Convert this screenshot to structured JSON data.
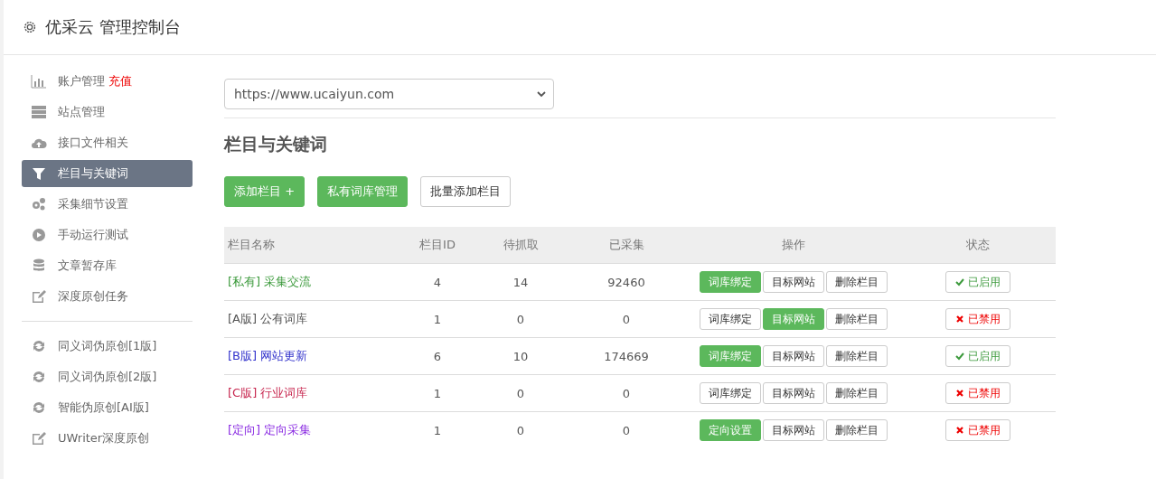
{
  "header": {
    "title": "优采云 管理控制台"
  },
  "sidebar": {
    "items": [
      {
        "label": "账户管理",
        "badge": "充值",
        "selected": false
      },
      {
        "label": "站点管理",
        "selected": false
      },
      {
        "label": "接口文件相关",
        "selected": false
      },
      {
        "label": "栏目与关键词",
        "selected": true
      },
      {
        "label": "采集细节设置",
        "selected": false
      },
      {
        "label": "手动运行测试",
        "selected": false
      },
      {
        "label": "文章暂存库",
        "selected": false
      },
      {
        "label": "深度原创任务",
        "selected": false
      },
      {
        "kind": "divider"
      },
      {
        "label": "同义词伪原创[1版]",
        "selected": false
      },
      {
        "label": "同义词伪原创[2版]",
        "selected": false
      },
      {
        "label": "智能伪原创[AI版]",
        "selected": false
      },
      {
        "label": "UWriter深度原创",
        "selected": false
      }
    ]
  },
  "site_select": {
    "value": "https://www.ucaiyun.com"
  },
  "section_title": "栏目与关键词",
  "toolbar": [
    {
      "label": "添加栏目 +",
      "primary": true
    },
    {
      "label": "私有词库管理",
      "primary": true
    },
    {
      "label": "批量添加栏目",
      "primary": false
    }
  ],
  "table": {
    "columns": [
      "栏目名称",
      "栏目ID",
      "待抓取",
      "已采集",
      "操作",
      "状态"
    ],
    "rows": [
      {
        "tag": "[私有]",
        "name": "采集交流",
        "color": "#3c9a3c",
        "id": "4",
        "pending": "14",
        "collected": "92460",
        "actions": [
          {
            "label": "词库绑定",
            "active": true
          },
          {
            "label": "目标网站",
            "active": false
          },
          {
            "label": "删除栏目",
            "active": false
          }
        ],
        "enabled": true,
        "status": "已启用"
      },
      {
        "tag": "[A版]",
        "name": "公有词库",
        "color": "#555555",
        "id": "1",
        "pending": "0",
        "collected": "0",
        "actions": [
          {
            "label": "词库绑定",
            "active": false
          },
          {
            "label": "目标网站",
            "active": true
          },
          {
            "label": "删除栏目",
            "active": false
          }
        ],
        "enabled": false,
        "status": "已禁用"
      },
      {
        "tag": "[B版]",
        "name": "网站更新",
        "color": "#3333cc",
        "id": "6",
        "pending": "10",
        "collected": "174669",
        "actions": [
          {
            "label": "词库绑定",
            "active": true
          },
          {
            "label": "目标网站",
            "active": false
          },
          {
            "label": "删除栏目",
            "active": false
          }
        ],
        "enabled": true,
        "status": "已启用"
      },
      {
        "tag": "[C版]",
        "name": "行业词库",
        "color": "#c7254e",
        "id": "1",
        "pending": "0",
        "collected": "0",
        "actions": [
          {
            "label": "词库绑定",
            "active": false
          },
          {
            "label": "目标网站",
            "active": false
          },
          {
            "label": "删除栏目",
            "active": false
          }
        ],
        "enabled": false,
        "status": "已禁用"
      },
      {
        "tag": "[定向]",
        "name": "定向采集",
        "color": "#8a2be2",
        "id": "1",
        "pending": "0",
        "collected": "0",
        "actions": [
          {
            "label": "定向设置",
            "active": true
          },
          {
            "label": "目标网站",
            "active": false
          },
          {
            "label": "删除栏目",
            "active": false
          }
        ],
        "enabled": false,
        "status": "已禁用"
      }
    ]
  }
}
